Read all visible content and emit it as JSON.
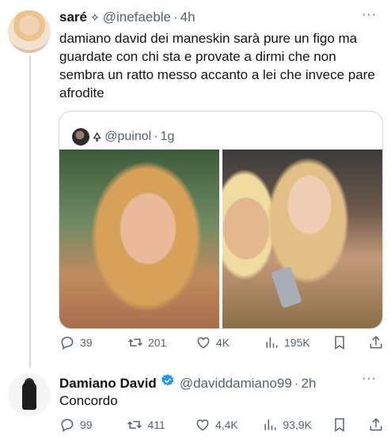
{
  "tweet": {
    "author_name": "saré",
    "author_symbol": "✧",
    "handle": "@inefaeble",
    "separator": "·",
    "time": "4h",
    "more": "···",
    "text": "damiano david dei maneskin sarà pure un figo ma guardate con chi sta e provate a dirmi che non sembra un ratto messo accanto a lei che invece pare afrodite",
    "quote": {
      "name_symbol": "🜍",
      "handle": "@puinol",
      "separator": "·",
      "time": "1g"
    },
    "actions": {
      "replies": "39",
      "retweets": "201",
      "likes": "4K",
      "views": "195K"
    }
  },
  "reply": {
    "author_name": "Damiano David",
    "handle": "@daviddamiano99",
    "separator": "·",
    "time": "2h",
    "more": "···",
    "text": "Concordo",
    "actions": {
      "replies": "99",
      "retweets": "411",
      "likes": "4,4K",
      "views": "93,9K"
    }
  },
  "colors": {
    "verified": "#1d9bf0",
    "muted": "#536471",
    "thread_line": "#cfd9de"
  },
  "icons": [
    "reply-icon",
    "retweet-icon",
    "like-icon",
    "views-icon",
    "bookmark-icon",
    "share-icon",
    "verified-badge-icon"
  ]
}
